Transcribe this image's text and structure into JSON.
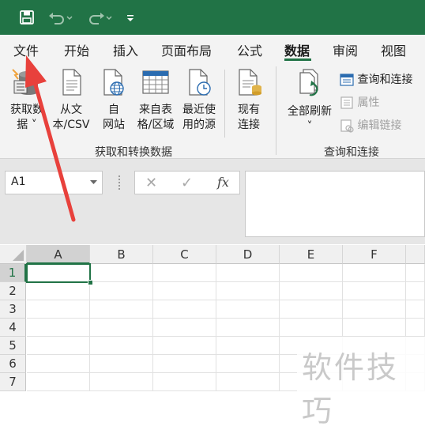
{
  "qat": {
    "save_icon": "save-icon",
    "undo_icon": "undo-icon",
    "redo_icon": "redo-icon",
    "customize_icon": "customize-qat-icon"
  },
  "tabs": [
    {
      "label": "文件"
    },
    {
      "label": "开始"
    },
    {
      "label": "插入"
    },
    {
      "label": "页面布局"
    },
    {
      "label": "公式"
    },
    {
      "label": "数据",
      "active": true
    },
    {
      "label": "审阅"
    },
    {
      "label": "视图"
    }
  ],
  "ribbon": {
    "get_transform": {
      "group_label": "获取和转换数据",
      "get_data": {
        "line1": "获取数",
        "line2": "据 ˅"
      },
      "from_text": {
        "line1": "从文",
        "line2": "本/CSV"
      },
      "from_web": {
        "line1": "自",
        "line2": "网站"
      },
      "from_table": {
        "line1": "来自表",
        "line2": "格/区域"
      },
      "recent_sources": {
        "line1": "最近使",
        "line2": "用的源"
      },
      "existing_conn": {
        "line1": "现有",
        "line2": "连接"
      }
    },
    "queries": {
      "group_label": "查询和连接",
      "refresh_all": {
        "line1": "全部刷新",
        "chevron": "˅"
      },
      "queries_connections": "查询和连接",
      "properties": "属性",
      "edit_links": "编辑链接"
    }
  },
  "formula_bar": {
    "namebox_value": "A1",
    "cancel_glyph": "✕",
    "enter_glyph": "✓",
    "fx_label": "fx",
    "formula_value": ""
  },
  "sheet": {
    "columns": [
      "A",
      "B",
      "C",
      "D",
      "E",
      "F"
    ],
    "rows": [
      "1",
      "2",
      "3",
      "4",
      "5",
      "6",
      "7"
    ],
    "active_cell": "A1"
  },
  "watermark": {
    "text": "软件技巧"
  },
  "colors": {
    "accent": "#217346",
    "arrow": "#e8413c"
  }
}
